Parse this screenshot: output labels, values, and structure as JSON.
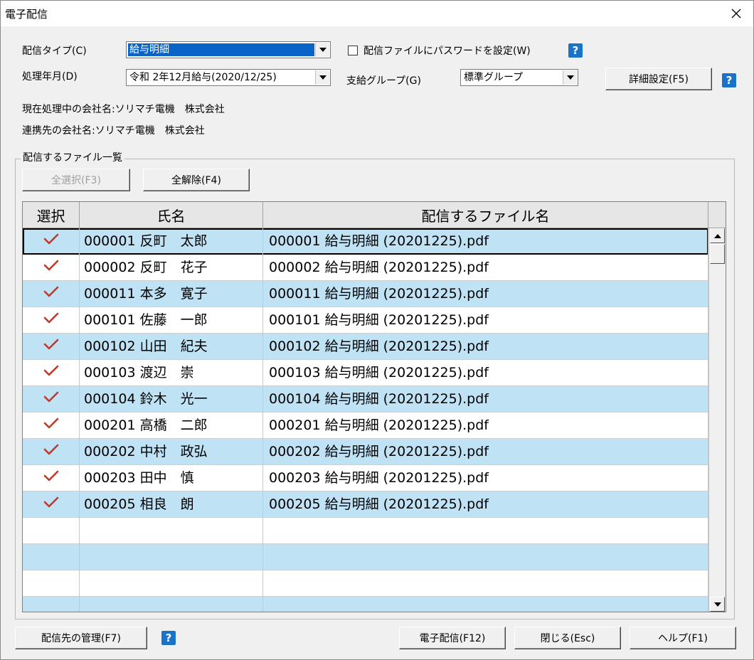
{
  "window": {
    "title": "電子配信"
  },
  "form": {
    "type_label": "配信タイプ(C)",
    "type_value": "給与明細",
    "password_label": "配信ファイルにパスワードを設定(W)",
    "period_label": "処理年月(D)",
    "period_value": "令和 2年12月給与(2020/12/25)",
    "group_label": "支給グループ(G)",
    "group_value": "標準グループ",
    "detail_button": "詳細設定(F5)",
    "current_company": "現在処理中の会社名:ソリマチ電機　株式会社",
    "linked_company": "連携先の会社名:ソリマチ電機　株式会社",
    "help_glyph": "?"
  },
  "files": {
    "group_label": "配信するファイル一覧",
    "select_all": "全選択(F3)",
    "deselect_all": "全解除(F4)",
    "columns": [
      "選択",
      "氏名",
      "配信するファイル名"
    ],
    "rows": [
      {
        "checked": true,
        "name": "000001 反町　太郎",
        "file": "000001 給与明細 (20201225).pdf"
      },
      {
        "checked": true,
        "name": "000002 反町　花子",
        "file": "000002 給与明細 (20201225).pdf"
      },
      {
        "checked": true,
        "name": "000011 本多　寛子",
        "file": "000011 給与明細 (20201225).pdf"
      },
      {
        "checked": true,
        "name": "000101 佐藤　一郎",
        "file": "000101 給与明細 (20201225).pdf"
      },
      {
        "checked": true,
        "name": "000102 山田　紀夫",
        "file": "000102 給与明細 (20201225).pdf"
      },
      {
        "checked": true,
        "name": "000103 渡辺　崇",
        "file": "000103 給与明細 (20201225).pdf"
      },
      {
        "checked": true,
        "name": "000104 鈴木　光一",
        "file": "000104 給与明細 (20201225).pdf"
      },
      {
        "checked": true,
        "name": "000201 高橋　二郎",
        "file": "000201 給与明細 (20201225).pdf"
      },
      {
        "checked": true,
        "name": "000202 中村　政弘",
        "file": "000202 給与明細 (20201225).pdf"
      },
      {
        "checked": true,
        "name": "000203 田中　慎",
        "file": "000203 給与明細 (20201225).pdf"
      },
      {
        "checked": true,
        "name": "000205 相良　朗",
        "file": "000205 給与明細 (20201225).pdf"
      },
      {
        "checked": false,
        "name": "",
        "file": ""
      },
      {
        "checked": false,
        "name": "",
        "file": ""
      },
      {
        "checked": false,
        "name": "",
        "file": ""
      },
      {
        "checked": false,
        "name": "",
        "file": ""
      }
    ]
  },
  "footer": {
    "manage_button": "配信先の管理(F7)",
    "send_button": "電子配信(F12)",
    "close_button": "閉じる(Esc)",
    "help_button": "ヘルプ(F1)"
  },
  "colors": {
    "row_alt": "#bfe2f5",
    "check": "#c0392b",
    "help": "#1a73c8",
    "selection": "#0a64c8"
  }
}
